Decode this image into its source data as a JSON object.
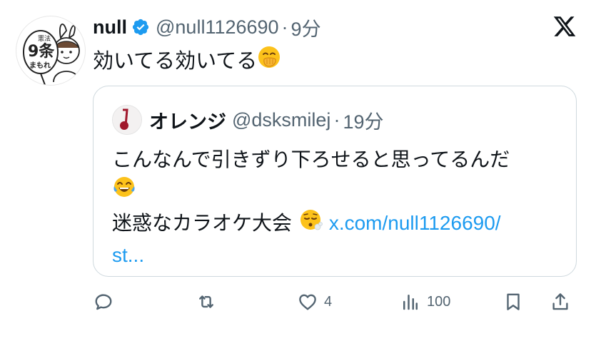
{
  "tweet": {
    "author_name": "null",
    "author_handle": "@null1126690",
    "separator": "·",
    "time": "9分",
    "text": "効いてる効いてる",
    "emoji_icon": "hand-over-mouth-icon",
    "avatar_text": [
      "9条",
      "まもれ",
      "憲法"
    ]
  },
  "quote": {
    "author_name": "オレンジ",
    "author_handle": "@dsksmilej",
    "separator": "·",
    "time": "19分",
    "line1": "こんなんで引きずり下ろせると思ってるんだ",
    "line2_emoji_icon": "tears-of-joy-icon",
    "line3_text": "迷惑なカラオケ大会",
    "line3_emoji_icon": "face-exhaling-icon",
    "link_part1": "x.com/null1126690/",
    "link_part2": "st..."
  },
  "actions": {
    "reply_count": "",
    "retweet_count": "",
    "like_count": "4",
    "views_count": "100"
  },
  "colors": {
    "text": "#0f1419",
    "secondary": "#536471",
    "link": "#1d9bf0",
    "verified": "#1d9bf0",
    "border": "#cfd9de"
  }
}
